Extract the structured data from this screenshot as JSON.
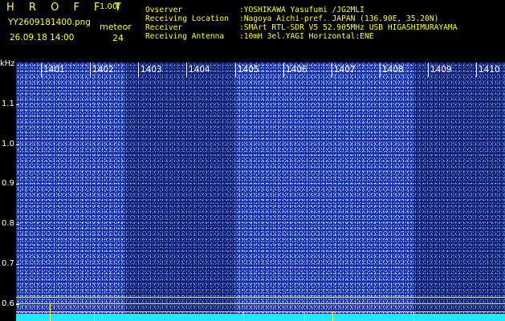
{
  "header": {
    "title": "H R O F F T",
    "version": "1.00f",
    "filename": "YY2609181400.png",
    "datetime": "26.09.18 14:00",
    "meteor_label": "meteor",
    "meteor_count": "24",
    "meta": [
      {
        "key": "Ovserver",
        "value": ":YOSHIKAWA Yasufumi /JG2MLI"
      },
      {
        "key": "Receiving Location",
        "value": ":Nagoya Aichi-pref. JAPAN (136.90E, 35.20N)"
      },
      {
        "key": "Receiver",
        "value": ":SMArt RTL-SDR V5 52.905MHz USB HIGASHIMURAYAMA"
      },
      {
        "key": "Receiving Antenna",
        "value": ":10mH 3el.YAGI Horizontal:ENE"
      }
    ]
  },
  "spectrogram": {
    "y_unit": "kHz",
    "y_ticks": [
      "1.1",
      "1.0",
      "0.9",
      "0.8",
      "0.7",
      "0.6"
    ],
    "x_ticks": [
      "1401",
      "1402",
      "1403",
      "1404",
      "1405",
      "1406",
      "1407",
      "1408",
      "1409",
      "1410"
    ],
    "colors": {
      "background": "#1a2aa6",
      "dark_band": "#141e86",
      "text": "#ffff2a",
      "baseline_noise": "#1fe8ff"
    }
  }
}
